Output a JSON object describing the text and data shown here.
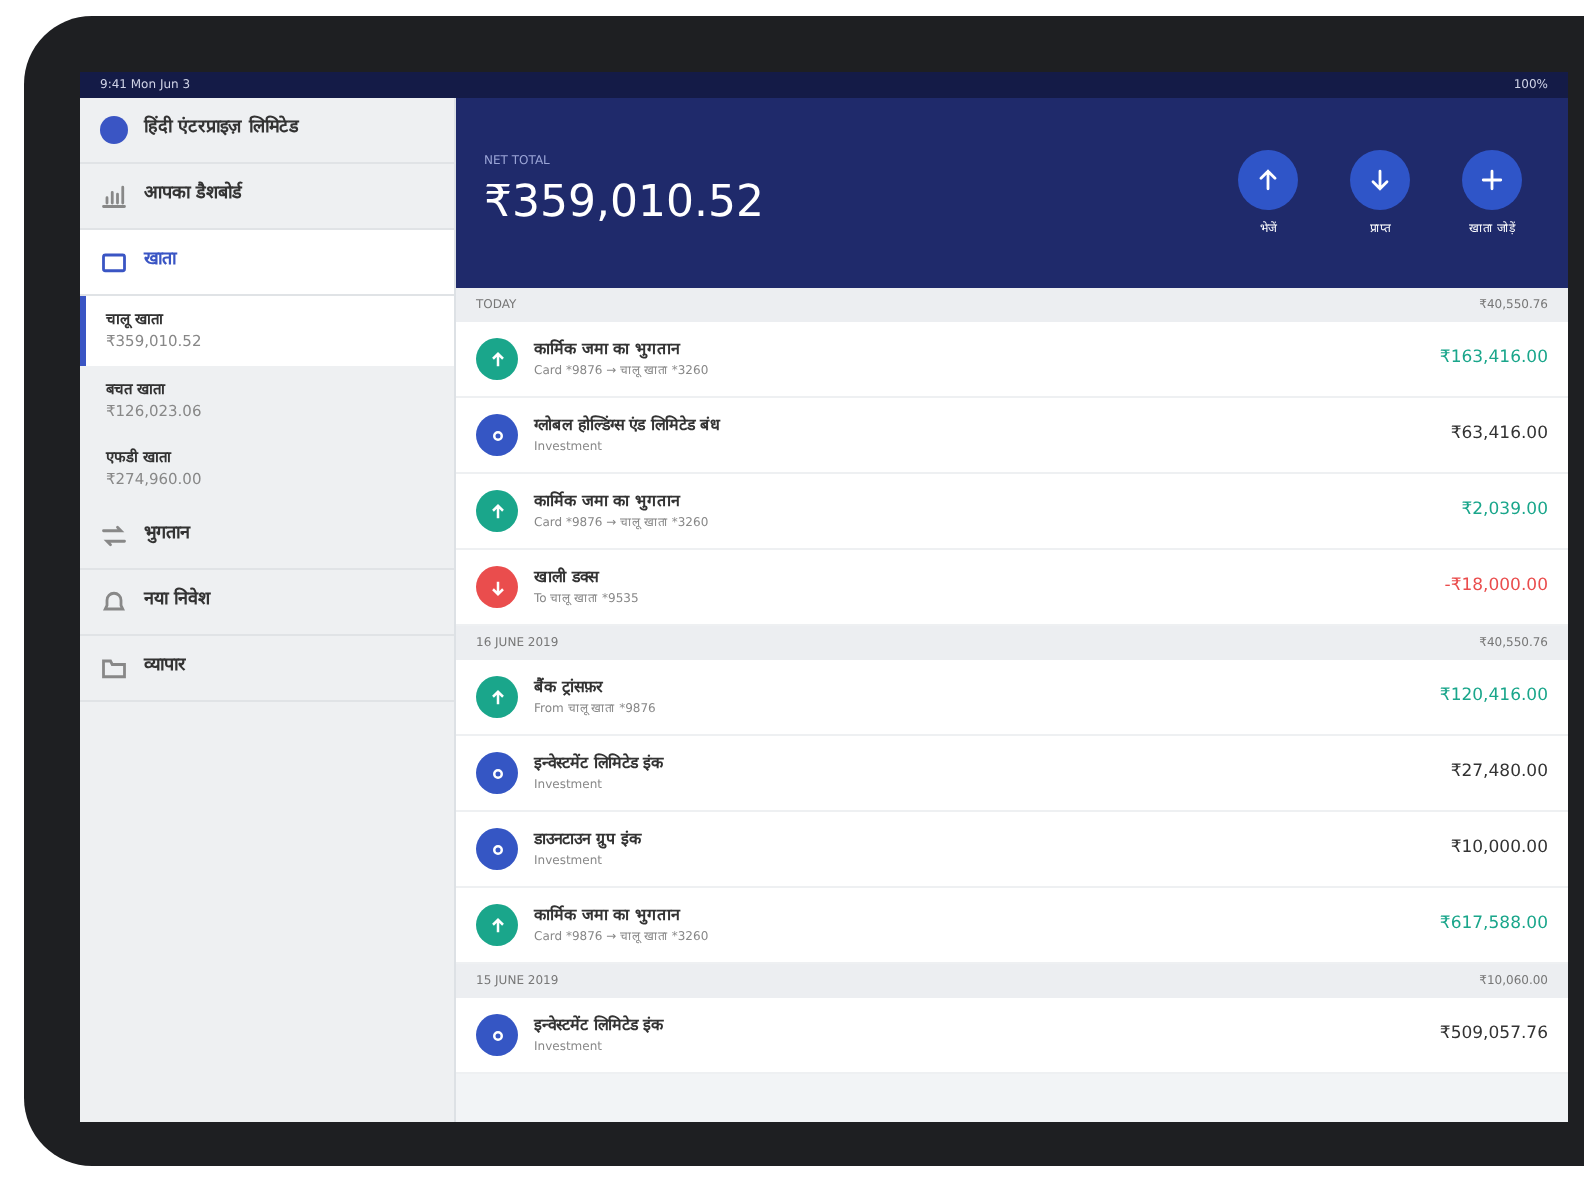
{
  "status_bar": {
    "time": "9:41 Mon Jun 3",
    "battery": "100%"
  },
  "sidebar": {
    "company": "हिंदी एंटरप्राइज़ लिमिटेड",
    "items": [
      {
        "label": "आपका डैशबोर्ड",
        "selected": false
      },
      {
        "label": "खाता",
        "selected": true,
        "children": [
          {
            "name": "चालू खाता",
            "balance": "₹359,010.52",
            "selected": true
          },
          {
            "name": "बचत खाता",
            "balance": "₹126,023.06",
            "selected": false
          },
          {
            "name": "एफडी खाता",
            "balance": "₹274,960.00",
            "selected": false
          }
        ]
      },
      {
        "label": "भुगतान",
        "selected": false
      },
      {
        "label": "नया निवेश",
        "selected": false
      },
      {
        "label": "व्यापार",
        "selected": false
      }
    ]
  },
  "header": {
    "label": "NET TOTAL",
    "balance": "₹359,010.52",
    "actions": [
      {
        "label": "भेजें"
      },
      {
        "label": "प्राप्त"
      },
      {
        "label": "खाता जोड़ें"
      }
    ]
  },
  "groups": [
    {
      "date": "TODAY",
      "total": "₹40,550.76",
      "transactions": [
        {
          "kind": "in",
          "title": "कार्मिक जमा का भुगतान",
          "detail": "Card *9876 → चालू खाता *3260",
          "amount": "₹163,416.00"
        },
        {
          "kind": "investment",
          "title": "ग्लोबल होल्डिंग्स एंड लिमिटेड बंध",
          "detail": "Investment",
          "amount": "₹63,416.00"
        },
        {
          "kind": "in",
          "title": "कार्मिक जमा का भुगतान",
          "detail": "Card *9876 → चालू खाता *3260",
          "amount": "₹2,039.00"
        },
        {
          "kind": "out",
          "title": "खाली डक्स",
          "detail": "To चालू खाता *9535",
          "amount": "-₹18,000.00"
        }
      ]
    },
    {
      "date": "16 JUNE 2019",
      "total": "₹40,550.76",
      "transactions": [
        {
          "kind": "in",
          "title": "बैंक ट्रांसफ़र",
          "detail": "From चालू खाता *9876",
          "amount": "₹120,416.00"
        },
        {
          "kind": "investment",
          "title": "इन्वेस्टमेंट लिमिटेड इंक",
          "detail": "Investment",
          "amount": "₹27,480.00"
        },
        {
          "kind": "investment",
          "title": "डाउनटाउन ग्रुप इंक",
          "detail": "Investment",
          "amount": "₹10,000.00"
        },
        {
          "kind": "in",
          "title": "कार्मिक जमा का भुगतान",
          "detail": "Card *9876 → चालू खाता *3260",
          "amount": "₹617,588.00"
        }
      ]
    },
    {
      "date": "15 JUNE 2019",
      "total": "₹10,060.00",
      "transactions": [
        {
          "kind": "investment",
          "title": "इन्वेस्टमेंट लिमिटेड इंक",
          "detail": "Investment",
          "amount": "₹509,057.76"
        }
      ]
    }
  ]
}
